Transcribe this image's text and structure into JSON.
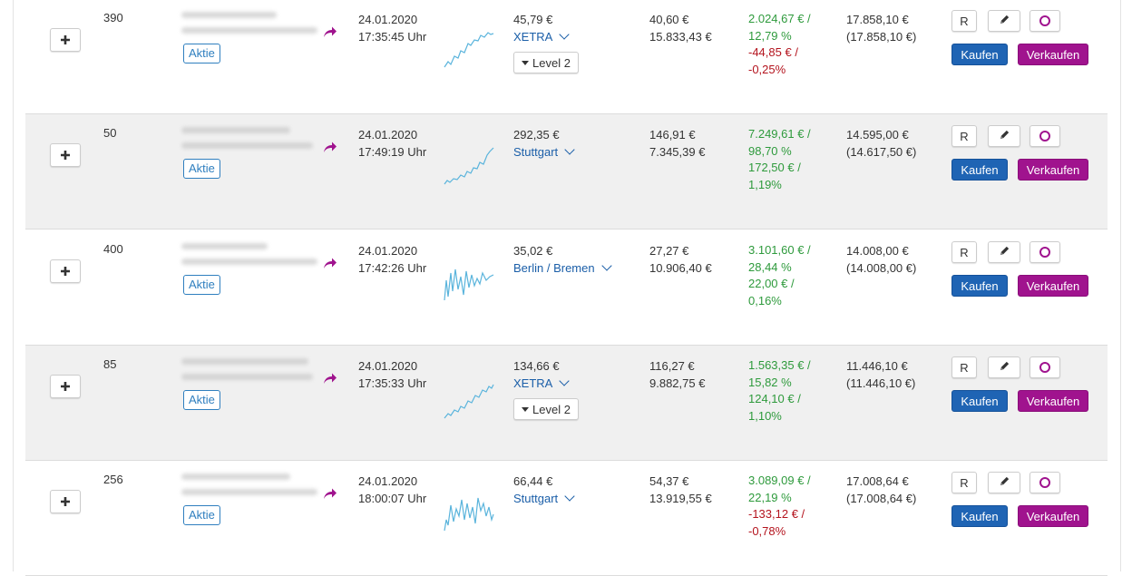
{
  "colors": {
    "link": "#1a5ea8",
    "gain": "#2e9a3c",
    "loss": "#b4141e",
    "buy": "#1f64b4",
    "sell": "#a0138e",
    "badge": "#2f7fbf"
  },
  "icons": {
    "expand": "plus-icon",
    "detail": "share-arrow-icon",
    "edit": "pencil-icon",
    "watch": "circle-icon",
    "menu": "caret-down-icon"
  },
  "labels": {
    "type": "Aktie",
    "r": "R",
    "buy": "Kaufen",
    "sell": "Verkaufen",
    "level2": "Level 2"
  },
  "rows": [
    {
      "qty": "390",
      "date": "24.01.2020",
      "time": "17:35:45 Uhr",
      "price": "45,79 €",
      "exchange": "XETRA",
      "level2": true,
      "buy_price": "40,60 €",
      "buy_total": "15.833,43 €",
      "perf_total": "2.024,67 € /",
      "perf_total_pct": "12,79 %",
      "perf_day": "-44,85 € /",
      "perf_day_pct": "-0,25%",
      "total_day_sign": "loss",
      "value": "17.858,10 €",
      "value_sub": "(17.858,10 €)"
    },
    {
      "qty": "50",
      "date": "24.01.2020",
      "time": "17:49:19 Uhr",
      "price": "292,35 €",
      "exchange": "Stuttgart",
      "level2": false,
      "buy_price": "146,91 €",
      "buy_total": "7.345,39 €",
      "perf_total": "7.249,61 € /",
      "perf_total_pct": "98,70 %",
      "perf_day": "172,50 € /",
      "perf_day_pct": "1,19%",
      "total_day_sign": "gain",
      "value": "14.595,00 €",
      "value_sub": "(14.617,50 €)"
    },
    {
      "qty": "400",
      "date": "24.01.2020",
      "time": "17:42:26 Uhr",
      "price": "35,02 €",
      "exchange": "Berlin / Bremen",
      "level2": false,
      "buy_price": "27,27 €",
      "buy_total": "10.906,40 €",
      "perf_total": "3.101,60 € /",
      "perf_total_pct": "28,44 %",
      "perf_day": "22,00 € /",
      "perf_day_pct": "0,16%",
      "total_day_sign": "gain",
      "value": "14.008,00 €",
      "value_sub": "(14.008,00 €)"
    },
    {
      "qty": "85",
      "date": "24.01.2020",
      "time": "17:35:33 Uhr",
      "price": "134,66 €",
      "exchange": "XETRA",
      "level2": true,
      "buy_price": "116,27 €",
      "buy_total": "9.882,75 €",
      "perf_total": "1.563,35 € /",
      "perf_total_pct": "15,82 %",
      "perf_day": "124,10 € /",
      "perf_day_pct": "1,10%",
      "total_day_sign": "gain",
      "value": "11.446,10 €",
      "value_sub": "(11.446,10 €)"
    },
    {
      "qty": "256",
      "date": "24.01.2020",
      "time": "18:00:07 Uhr",
      "price": "66,44 €",
      "exchange": "Stuttgart",
      "level2": false,
      "buy_price": "54,37 €",
      "buy_total": "13.919,55 €",
      "perf_total": "3.089,09 € /",
      "perf_total_pct": "22,19 %",
      "perf_day": "-133,12 € /",
      "perf_day_pct": "-0,78%",
      "total_day_sign": "loss",
      "value": "17.008,64 €",
      "value_sub": "(17.008,64 €)"
    }
  ]
}
